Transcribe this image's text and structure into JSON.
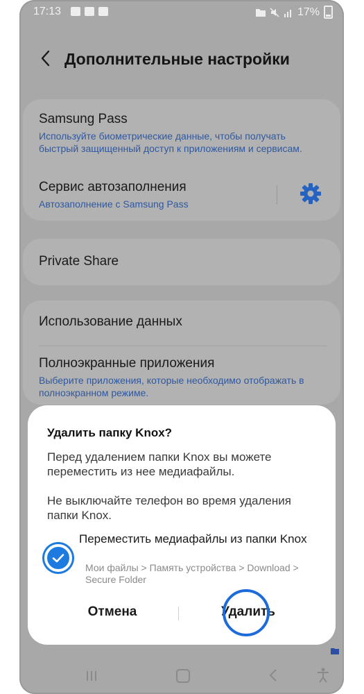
{
  "statusbar": {
    "time": "17:13",
    "battery": "17%"
  },
  "header": {
    "title": "Дополнительные настройки"
  },
  "settings": {
    "samsung_pass": {
      "title": "Samsung Pass",
      "desc": "Используйте биометрические данные, чтобы получать быстрый защищенный доступ к приложениям и сервисам."
    },
    "autofill": {
      "title": "Сервис автозаполнения",
      "desc": "Автозаполнение с Samsung Pass"
    },
    "private_share": {
      "title": "Private Share"
    },
    "data_usage": {
      "title": "Использование данных"
    },
    "fullscreen": {
      "title": "Полноэкранные приложения",
      "desc": "Выберите приложения, которые необходимо отображать в полноэкранном режиме."
    }
  },
  "dialog": {
    "title": "Удалить папку Knox?",
    "text1": "Перед удалением папки Knox вы можете переместить из нее медиафайлы.",
    "text2": "Не выключайте телефон во время удаления папки Knox.",
    "checkbox_label": "Переместить медиафайлы из папки Knox",
    "checkbox_checked": true,
    "checkbox_path": "Мои файлы > Память устройства > Download > Secure Folder",
    "cancel": "Отмена",
    "delete": "Удалить"
  },
  "colors": {
    "accent": "#1d7be0",
    "link_text": "#2f58a0"
  }
}
